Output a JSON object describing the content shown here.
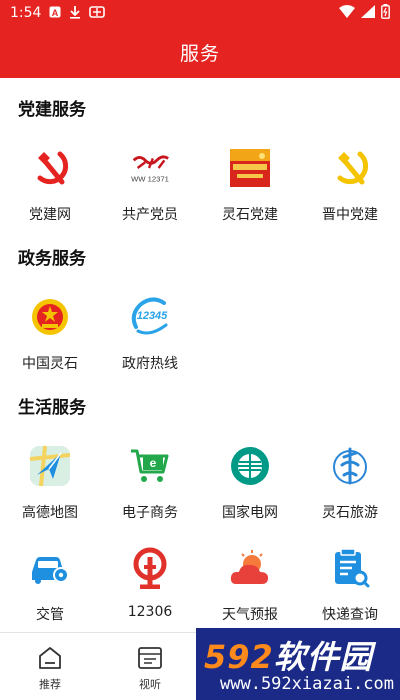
{
  "status_bar": {
    "time": "1:54",
    "icons": [
      "a-box-icon",
      "download-icon",
      "bug-icon"
    ],
    "right_icons": [
      "wifi-icon",
      "signal-icon",
      "battery-icon"
    ]
  },
  "header": {
    "title": "服务"
  },
  "sections": [
    {
      "title": "党建服务",
      "items": [
        {
          "label": "党建网",
          "icon": "hammer-sickle-red-icon"
        },
        {
          "label": "共产党员",
          "icon": "gcdy-12371-logo-icon",
          "logo_text": "WW 12371"
        },
        {
          "label": "灵石党建",
          "icon": "lingshi-party-banner-icon"
        },
        {
          "label": "晋中党建",
          "icon": "hammer-sickle-gold-icon"
        }
      ]
    },
    {
      "title": "政务服务",
      "items": [
        {
          "label": "中国灵石",
          "icon": "national-emblem-icon"
        },
        {
          "label": "政府热线",
          "icon": "hotline-12345-icon",
          "logo_text": "12345"
        }
      ]
    },
    {
      "title": "生活服务",
      "items": [
        {
          "label": "高德地图",
          "icon": "amap-icon"
        },
        {
          "label": "电子商务",
          "icon": "shopping-cart-icon"
        },
        {
          "label": "国家电网",
          "icon": "state-grid-icon"
        },
        {
          "label": "灵石旅游",
          "icon": "tourism-icon"
        },
        {
          "label": "交管",
          "icon": "car-settings-icon"
        },
        {
          "label": "12306",
          "icon": "railway-logo-icon"
        },
        {
          "label": "天气预报",
          "icon": "weather-icon"
        },
        {
          "label": "快递查询",
          "icon": "express-query-icon"
        }
      ]
    }
  ],
  "bottom_nav": [
    {
      "label": "推荐",
      "icon": "home-icon"
    },
    {
      "label": "视听",
      "icon": "media-icon"
    }
  ],
  "watermark": {
    "brand_num": "592",
    "brand_text": "软件园",
    "url": "www.592xiazai.com"
  },
  "colors": {
    "primary": "#e52421",
    "blue": "#1f8fe0",
    "green": "#22a84a",
    "gold": "#f5c400"
  }
}
